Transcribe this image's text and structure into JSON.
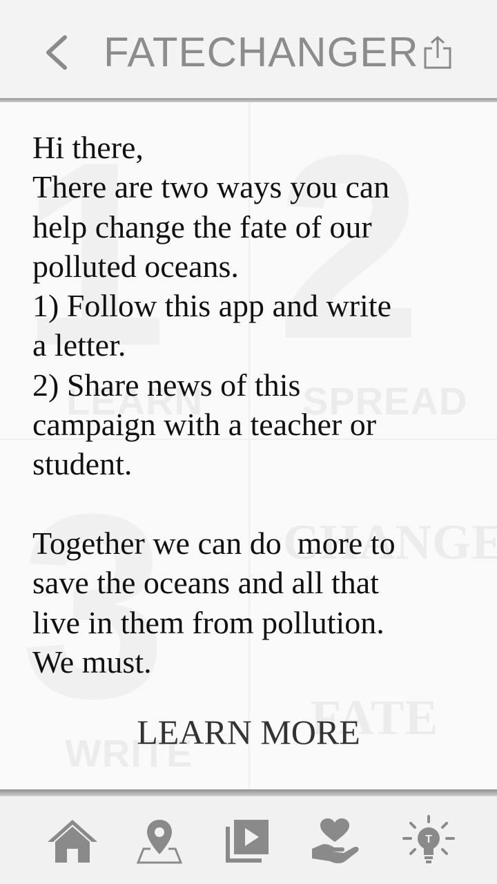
{
  "header": {
    "title": "FATECHANGER",
    "back_icon": "chevron-left-icon",
    "share_icon": "share-icon"
  },
  "watermark": {
    "labels": [
      "LEARN",
      "SPREAD",
      "CHANGE",
      "FATE",
      "WRITE"
    ],
    "numbers": [
      "1",
      "2",
      "3"
    ]
  },
  "message": {
    "text": "Hi there,\nThere are two ways you can\nhelp change the fate of our\npolluted oceans.\n1) Follow this app and write\na letter.\n2) Share news of this\ncampaign with a teacher or\nstudent.\n\nTogether we can do  more to\nsave the oceans and all that\nlive in them from pollution.\nWe must."
  },
  "learn_more": {
    "label": "LEARN MORE"
  },
  "bottom_nav": {
    "items": [
      {
        "icon": "home-icon"
      },
      {
        "icon": "map-pin-icon"
      },
      {
        "icon": "video-library-icon"
      },
      {
        "icon": "heart-hand-icon"
      },
      {
        "icon": "lightbulb-icon"
      }
    ]
  },
  "colors": {
    "icon_gray": "#8a8a8a",
    "title_gray": "#8c8c8c",
    "text": "#111111"
  }
}
